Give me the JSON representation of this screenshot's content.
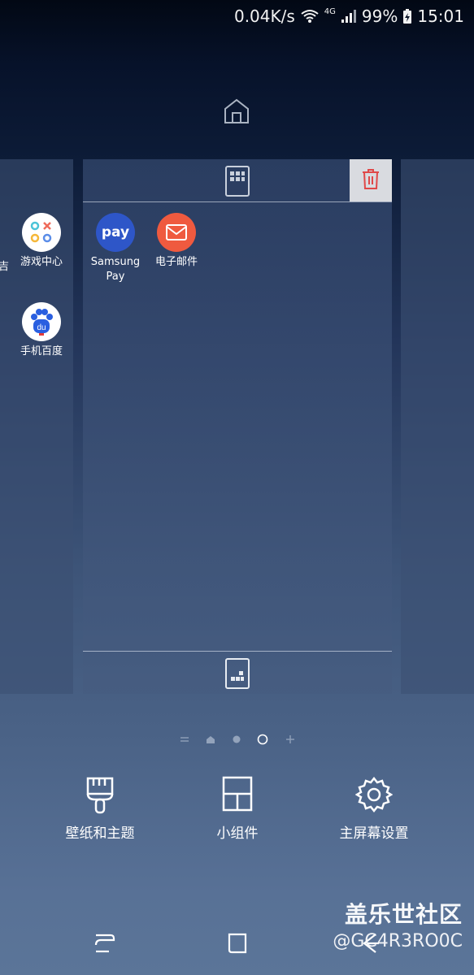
{
  "status_bar": {
    "net_speed": "0.04K/s",
    "network": "4G",
    "battery": "99%",
    "time": "15:01"
  },
  "left_panel": {
    "apps": [
      {
        "label": "游戏中心",
        "icon": "game-center-icon"
      },
      {
        "label": "手机百度",
        "icon": "baidu-icon"
      }
    ],
    "cut_label": "吉"
  },
  "center_panel": {
    "apps": [
      {
        "label": "Samsung Pay",
        "icon": "samsung-pay-icon",
        "text": "pay",
        "color": "#2e56c8"
      },
      {
        "label": "电子邮件",
        "icon": "email-icon",
        "color": "#ef5a3f"
      }
    ]
  },
  "actions": [
    {
      "label": "壁纸和主题",
      "icon": "paint-brush-icon"
    },
    {
      "label": "小组件",
      "icon": "widgets-icon"
    },
    {
      "label": "主屏幕设置",
      "icon": "gear-icon"
    }
  ],
  "watermark": {
    "title": "盖乐世社区",
    "user": "@GC4R3RO0C"
  },
  "colors": {
    "trash": "#e04848",
    "accent": "#2e56c8"
  }
}
